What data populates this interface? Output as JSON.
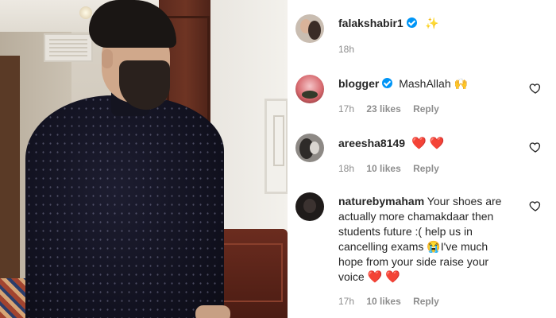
{
  "post": {
    "author": "falakshabir1",
    "caption_emoji": "✨",
    "time": "18h"
  },
  "comments": [
    {
      "username": "blogger",
      "verified": true,
      "text": "MashAllah",
      "emoji": "🙌",
      "time": "17h",
      "likes": "23 likes",
      "reply_label": "Reply"
    },
    {
      "username": "areesha8149",
      "verified": false,
      "text": "",
      "emoji": "❤️ ❤️",
      "time": "18h",
      "likes": "10 likes",
      "reply_label": "Reply"
    },
    {
      "username": "naturebymaham",
      "verified": false,
      "text_lines": [
        "Your shoes are",
        "actually more chamakdaar then",
        "students future :( help us in",
        "cancelling exams",
        "hope from your side raise your",
        "voice"
      ],
      "mid_emoji": "😭",
      "line4_tail": "I've much",
      "end_emoji": "❤️ ❤️",
      "time": "17h",
      "likes": "10 likes",
      "reply_label": "Reply"
    }
  ],
  "icons": {
    "verified": "verified-badge-icon",
    "heart": "heart-outline-icon"
  },
  "colors": {
    "verified": "#0095f6",
    "meta": "#8e8e8e",
    "text": "#262626"
  }
}
